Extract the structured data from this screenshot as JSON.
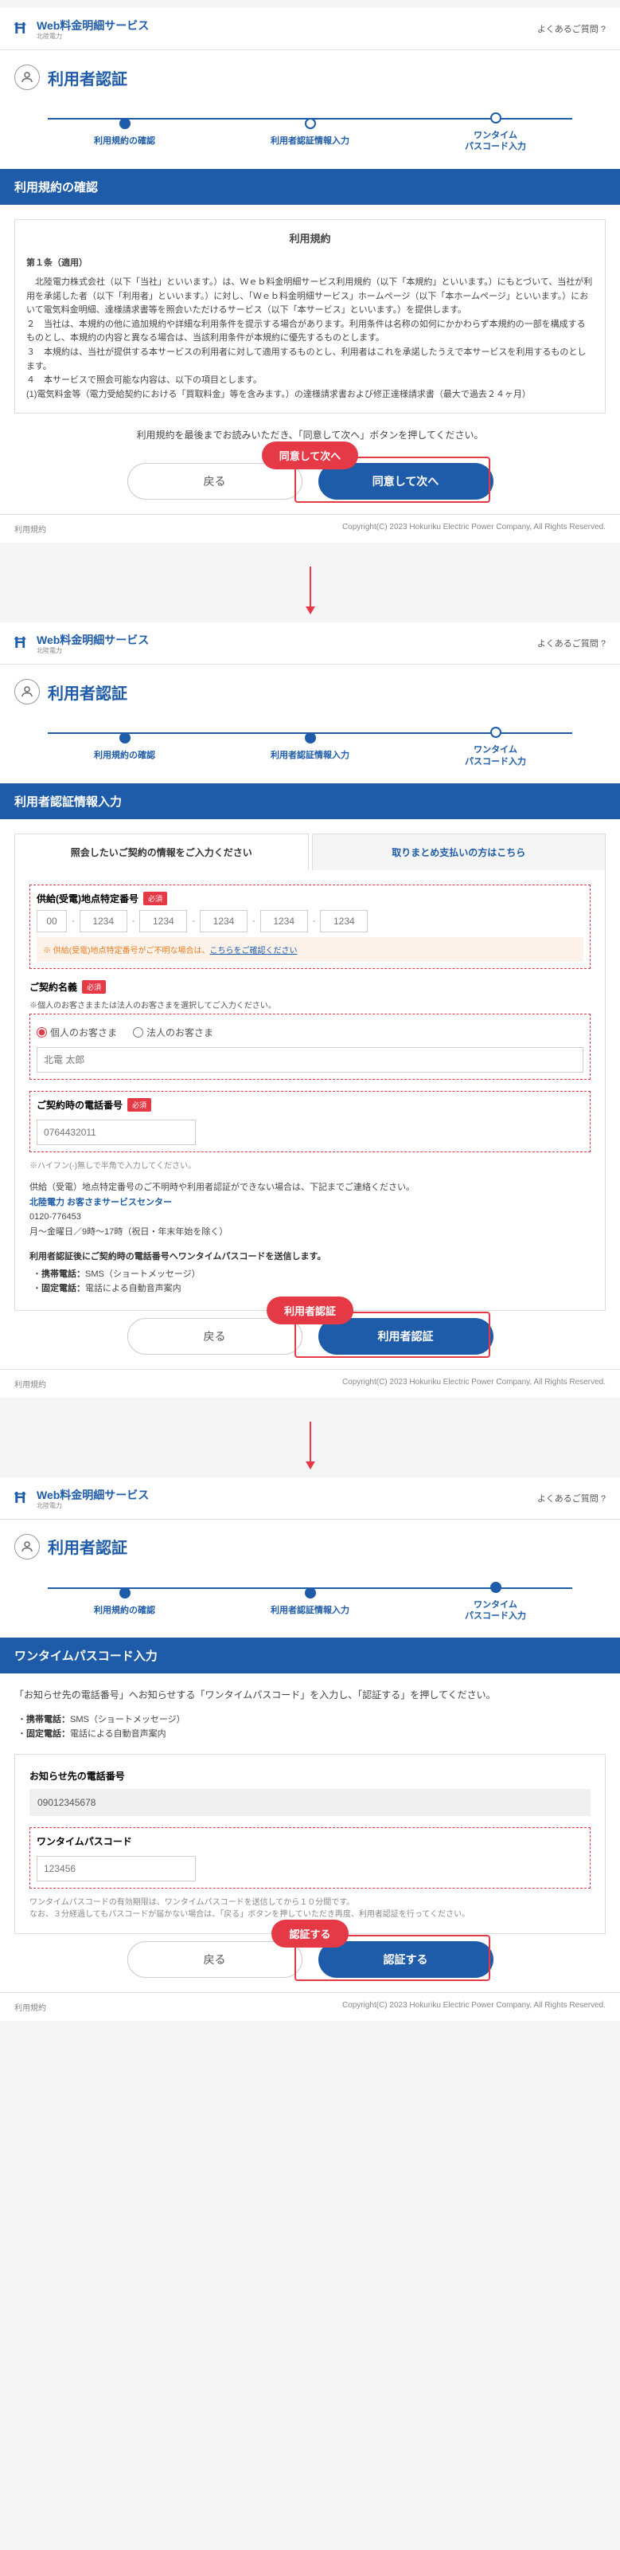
{
  "common": {
    "service_name": "Web料金明細サービス",
    "company": "北陸電力",
    "faq": "よくあるご質問 ?",
    "page_title": "利用者認証",
    "footer_left": "利用規約",
    "copyright": "Copyright(C) 2023 Hokuriku Electric Power Company, All Rights Reserved.",
    "back": "戻る",
    "steps": {
      "s1": "利用規約の確認",
      "s2": "利用者認証情報入力",
      "s3": "ワンタイム\nパスコード入力"
    }
  },
  "step1": {
    "section": "利用規約の確認",
    "terms_title": "利用規約",
    "article": "第１条（適用）",
    "body1": "　北陸電力株式会社（以下「当社」といいます。）は、Ｗｅｂ料金明細サービス利用規約（以下「本規約」といいます。）にもとづいて、当社が利用を承諾した者（以下「利用者」といいます。）に対し、「Ｗｅｂ料金明細サービス」ホームページ（以下「本ホームページ」といいます。）において電気料金明細、達様請求書等を照会いただけるサービス（以下「本サービス」といいます。）を提供します。",
    "body2": "２　当社は、本規約の他に追加規約や詳細な利用条件を提示する場合があります。利用条件は名称の如何にかかわらず本規約の一部を構成するものとし、本規約の内容と異なる場合は、当該利用条件が本規約に優先するものとします。",
    "body3": "３　本規約は、当社が提供する本サービスの利用者に対して適用するものとし、利用者はこれを承諾したうえで本サービスを利用するものとします。",
    "body4": "４　本サービスで照会可能な内容は、以下の項目とします。",
    "body5": "(1)電気料金等（電力受給契約における「買取料金」等を含みます。）の達様請求書および修正達様請求書（最大で過去２４ヶ月）",
    "instruction": "利用規約を最後までお読みいただき、「同意して次へ」ボタンを押してください。",
    "callout": "同意して次へ",
    "primary": "同意して次へ"
  },
  "step2": {
    "section": "利用者認証情報入力",
    "tab1": "照会したいご契約の情報をご入力ください",
    "tab2": "取りまとめ支払いの方はこちら",
    "supply_label": "供給(受電)地点特定番号",
    "required": "必須",
    "seg_ph": {
      "a": "00",
      "b": "1234"
    },
    "supply_warn_pre": "※ 供給(受電)地点特定番号がご不明な場合は、",
    "supply_warn_link": "こちらをご確認ください",
    "holder_label": "ご契約名義",
    "holder_note": "※個人のお客さままたは法人のお客さまを選択してご入力ください。",
    "radio_personal": "個人のお客さま",
    "radio_corp": "法人のお客さま",
    "name_ph": "北電 太郎",
    "phone_label": "ご契約時の電話番号",
    "phone_ph": "0764432011",
    "phone_help": "※ハイフン(-)無しで半角で入力してください。",
    "contact_intro": "供給（受電）地点特定番号のご不明時や利用者認証ができない場合は、下記までご連絡ください。",
    "contact_name": "北陸電力 お客さまサービスセンター",
    "contact_tel": "0120-776453",
    "contact_hours": "月～金曜日／9時～17時（祝日・年末年始を除く）",
    "passcode_note": "利用者認証後にご契約時の電話番号へワンタイムパスコードを送信します。",
    "pc_line1_a": "携帯電話：",
    "pc_line1_b": "SMS（ショートメッセージ）",
    "pc_line2_a": "固定電話：",
    "pc_line2_b": "電話による自動音声案内",
    "callout": "利用者認証",
    "primary": "利用者認証"
  },
  "step3": {
    "section": "ワンタイムパスコード入力",
    "instruction": "「お知らせ先の電話番号」へお知らせする「ワンタイムパスコード」を入力し、「認証する」を押してください。",
    "line1_a": "携帯電話：",
    "line1_b": "SMS（ショートメッセージ）",
    "line2_a": "固定電話：",
    "line2_b": "電話による自動音声案内",
    "dest_label": "お知らせ先の電話番号",
    "dest_value": "09012345678",
    "otp_label": "ワンタイムパスコード",
    "otp_ph": "123456",
    "validity": "ワンタイムパスコードの有効期限は、ワンタイムパスコードを送信してから１０分間です。\nなお、３分経過してもパスコードが届かない場合は、「戻る」ボタンを押していただき再度、利用者認証を行ってください。",
    "callout": "認証する",
    "primary": "認証する"
  }
}
